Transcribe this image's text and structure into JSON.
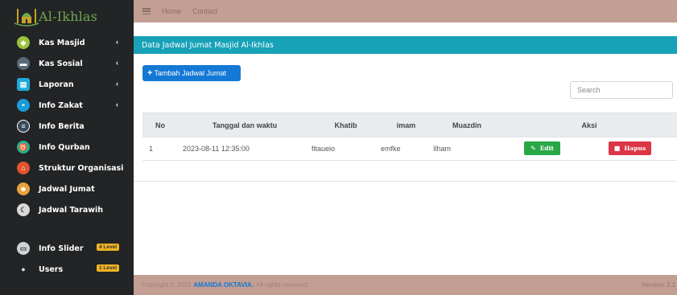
{
  "sidebar": {
    "brand": "Al-Ikhlas",
    "items": [
      {
        "label": "Kas Masjid",
        "icon": "mosque-coins-icon",
        "color": "#9bc23c",
        "caret": "‹"
      },
      {
        "label": "Kas Sosial",
        "icon": "wallet-icon",
        "color": "#5a6a78",
        "caret": "‹"
      },
      {
        "label": "Laporan",
        "icon": "report-icon",
        "color": "#1fa8d8",
        "caret": "‹"
      },
      {
        "label": "Info Zakat",
        "icon": "zakat-icon",
        "color": "#1a9bd7",
        "caret": "‹"
      },
      {
        "label": "Info Berita",
        "icon": "news-icon",
        "color": "#3b4a5a",
        "caret": ""
      },
      {
        "label": "Info Qurban",
        "icon": "cow-icon",
        "color": "#25b394",
        "caret": ""
      },
      {
        "label": "Struktur Organisasi",
        "icon": "org-icon",
        "color": "#e2542c",
        "caret": ""
      },
      {
        "label": "Jadwal Jumat",
        "icon": "calendar-person-icon",
        "color": "#e8a23c",
        "caret": ""
      },
      {
        "label": "Jadwal Tarawih",
        "icon": "moon-icon",
        "color": "#d9d9d9",
        "caret": ""
      },
      {
        "label": "Info Slider",
        "icon": "slider-icon",
        "color": "#cfd3d6",
        "caret": "",
        "badge": "4 Level"
      },
      {
        "label": "Users",
        "icon": "user-icon",
        "color": "#222426",
        "caret": "",
        "badge": "1 Level"
      }
    ]
  },
  "topbar": {
    "menu_icon": "hamburger-icon",
    "links": [
      "Home",
      "Contact"
    ]
  },
  "content": {
    "title": "Data Jadwal Jumat Masjid Al-Ikhlas",
    "add_button": "Tambah Jadwal Jumat",
    "search_placeholder": "Search"
  },
  "table": {
    "headers": [
      "No",
      "Tanggal dan waktu",
      "Khatib",
      "imam",
      "Muazdin",
      "Aksi"
    ],
    "rows": [
      {
        "no": "1",
        "datetime": "2023-08-11 12:35:00",
        "khatib": "fitaueio",
        "imam": "emfke",
        "muazdin": "Ilham",
        "edit": "Edit",
        "delete": "Hapus"
      }
    ]
  },
  "footer": {
    "prefix": "Copyright © 2023",
    "author": "AMANDA OKTAVIA.",
    "suffix": "All rights reserved.",
    "version": "Version 3.1"
  },
  "colors": {
    "sidebar_bg": "#222426",
    "topbar_bg": "#c39e93",
    "header_bg": "#17a2b8",
    "primary": "#1479d4",
    "success": "#28a745",
    "danger": "#dc3545"
  }
}
